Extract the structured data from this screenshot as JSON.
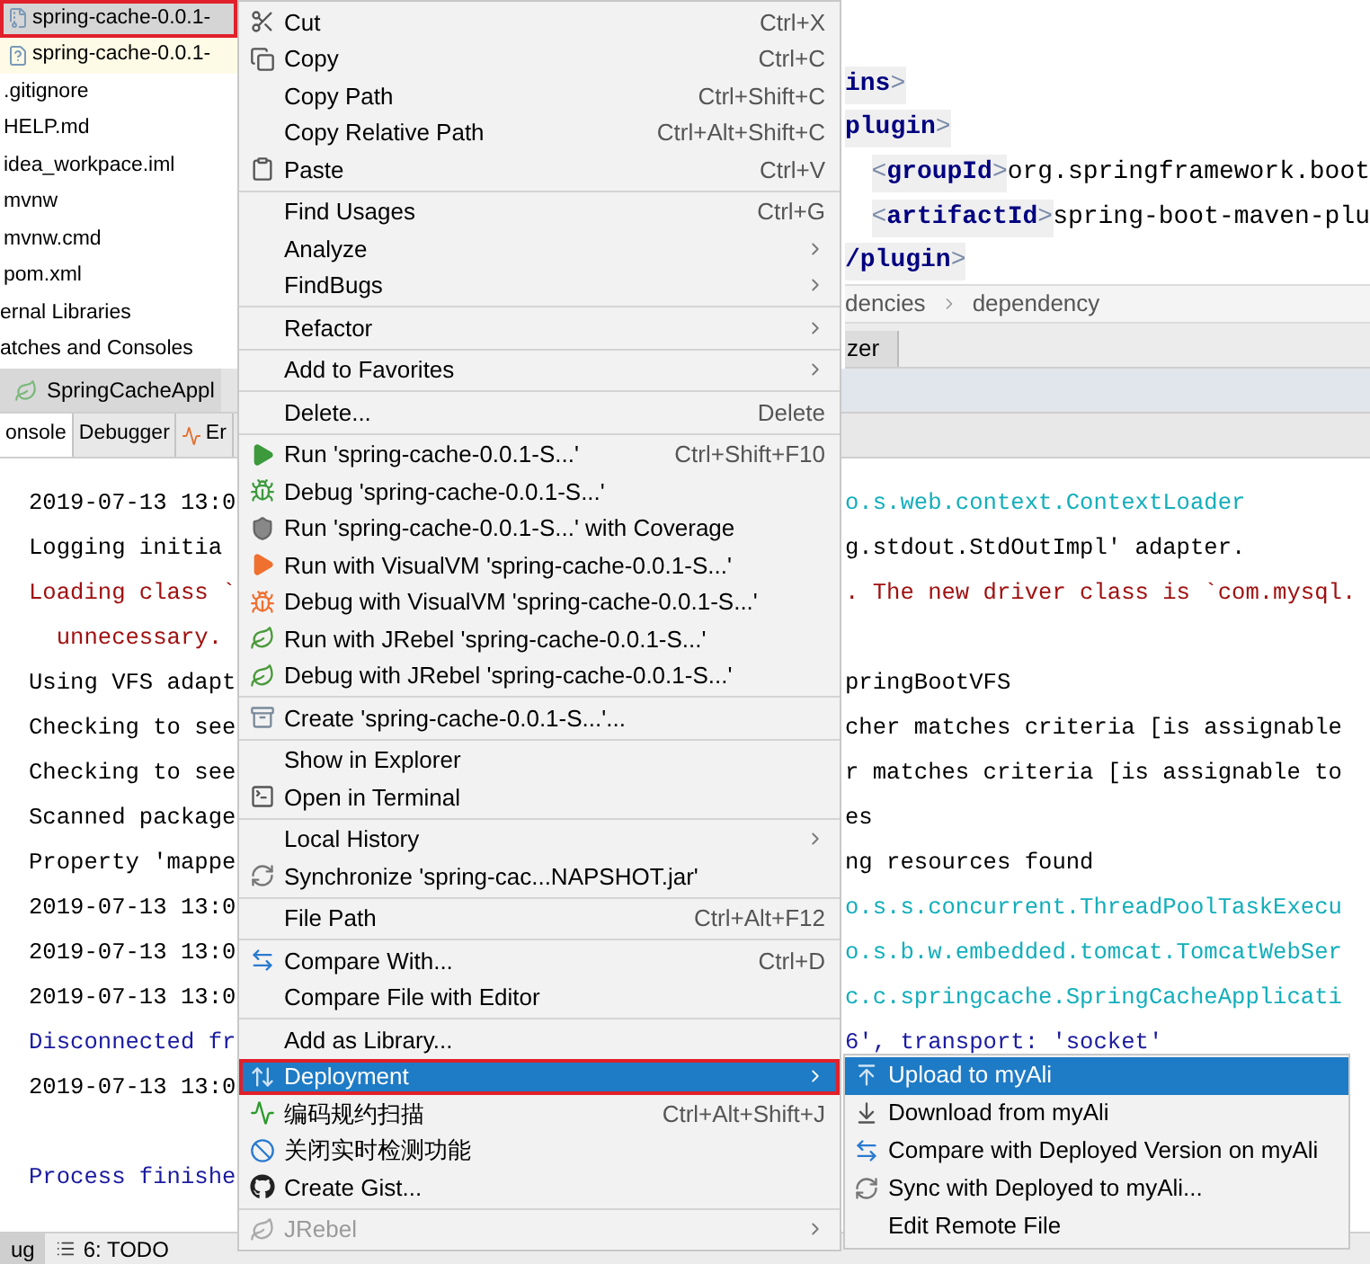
{
  "project_tree": [
    {
      "label": "spring-cache-0.0.1-",
      "kind": "archive",
      "selected": true,
      "highlighted": true
    },
    {
      "label": "spring-cache-0.0.1-",
      "kind": "unknown",
      "selected": false,
      "highlighted": false
    },
    {
      "label": ".gitignore",
      "kind": "file",
      "selected": false,
      "highlighted": false
    },
    {
      "label": "HELP.md",
      "kind": "file",
      "selected": false,
      "highlighted": false
    },
    {
      "label": "idea_workpace.iml",
      "kind": "file",
      "selected": false,
      "highlighted": false
    },
    {
      "label": "mvnw",
      "kind": "file",
      "selected": false,
      "highlighted": false
    },
    {
      "label": "mvnw.cmd",
      "kind": "file",
      "selected": false,
      "highlighted": false
    },
    {
      "label": "pom.xml",
      "kind": "file",
      "selected": false,
      "highlighted": false
    },
    {
      "label": "ernal Libraries",
      "kind": "node",
      "selected": false,
      "highlighted": false
    },
    {
      "label": "atches and Consoles",
      "kind": "node",
      "selected": false,
      "highlighted": false
    }
  ],
  "editor": {
    "lines": [
      [
        {
          "kind": "tag",
          "text": "ins"
        },
        {
          "kind": "punct",
          "text": ">"
        }
      ],
      [
        {
          "kind": "tag",
          "text": "plugin"
        },
        {
          "kind": "punct",
          "text": ">"
        }
      ],
      [
        {
          "kind": "indent"
        },
        {
          "kind": "punct",
          "text": "<"
        },
        {
          "kind": "tag",
          "text": "groupId"
        },
        {
          "kind": "punct",
          "text": ">"
        },
        {
          "kind": "value",
          "text": "org.springframework.boot"
        }
      ],
      [
        {
          "kind": "indent"
        },
        {
          "kind": "punct",
          "text": "<"
        },
        {
          "kind": "tag",
          "text": "artifactId"
        },
        {
          "kind": "punct",
          "text": ">"
        },
        {
          "kind": "value",
          "text": "spring-boot-maven-plu"
        }
      ],
      [
        {
          "kind": "tag",
          "text": "/plugin"
        },
        {
          "kind": "punct",
          "text": ">"
        }
      ]
    ],
    "breadcrumb": [
      "dencies",
      "dependency"
    ],
    "tool_tab": "zer"
  },
  "run_bar": {
    "title": "SpringCacheAppl"
  },
  "console_tabs": [
    {
      "label": "onsole",
      "selected": true
    },
    {
      "label": "Debugger",
      "selected": false
    },
    {
      "label": "Er",
      "selected": false
    }
  ],
  "console": [
    {
      "left": {
        "kind": "plain",
        "text": "2019-07-13 13:0"
      },
      "right": {
        "kind": "logger",
        "text": "o.s.web.context.ContextLoader"
      }
    },
    {
      "left": {
        "kind": "plain",
        "text": "Logging initia"
      },
      "right": {
        "kind": "plain",
        "text": "g.stdout.StdOutImpl' adapter."
      }
    },
    {
      "left": {
        "kind": "error",
        "text": "Loading class `"
      },
      "right": {
        "kind": "error",
        "text": ". The new driver class is `com.mysql."
      }
    },
    {
      "left": {
        "kind": "error",
        "text": "  unnecessary."
      }
    },
    {
      "left": {
        "kind": "plain",
        "text": "Using VFS adapt"
      },
      "right": {
        "kind": "plain",
        "text": "pringBootVFS"
      }
    },
    {
      "left": {
        "kind": "plain",
        "text": "Checking to see"
      },
      "right": {
        "kind": "plain",
        "text": "cher matches criteria [is assignable"
      }
    },
    {
      "left": {
        "kind": "plain",
        "text": "Checking to see"
      },
      "right": {
        "kind": "plain",
        "text": "r matches criteria [is assignable to"
      }
    },
    {
      "left": {
        "kind": "plain",
        "text": "Scanned package"
      },
      "right": {
        "kind": "plain",
        "text": "es"
      }
    },
    {
      "left": {
        "kind": "plain",
        "text": "Property 'mappe"
      },
      "right": {
        "kind": "plain",
        "text": "ng resources found"
      }
    },
    {
      "left": {
        "kind": "plain",
        "text": "2019-07-13 13:0"
      },
      "right": {
        "kind": "logger",
        "text": "o.s.s.concurrent.ThreadPoolTaskExecu"
      }
    },
    {
      "left": {
        "kind": "plain",
        "text": "2019-07-13 13:0"
      },
      "right": {
        "kind": "logger",
        "text": "o.s.b.w.embedded.tomcat.TomcatWebSer"
      }
    },
    {
      "left": {
        "kind": "plain",
        "text": "2019-07-13 13:0"
      },
      "right": {
        "kind": "logger",
        "text": "c.c.springcache.SpringCacheApplicati"
      }
    },
    {
      "left": {
        "kind": "system",
        "text": "Disconnected fr"
      },
      "right": {
        "kind": "system",
        "text": "6', transport: 'socket'"
      }
    },
    {
      "left": {
        "kind": "plain",
        "text": "2019-07-13 13:0"
      }
    },
    {
      "kind": "blank"
    },
    {
      "left": {
        "kind": "system",
        "text": "Process finishe"
      }
    }
  ],
  "bottom_tabs": [
    {
      "label": "ug",
      "selected": true
    },
    {
      "label": "6: TODO",
      "selected": false
    }
  ],
  "context_menu": [
    {
      "kind": "item",
      "label": "Cut",
      "shortcut": "Ctrl+X",
      "submenu": false,
      "selected": false,
      "disabled": false,
      "highlighted": false
    },
    {
      "kind": "item",
      "label": "Copy",
      "shortcut": "Ctrl+C",
      "submenu": false,
      "selected": false,
      "disabled": false,
      "highlighted": false
    },
    {
      "kind": "item",
      "label": "Copy Path",
      "shortcut": "Ctrl+Shift+C",
      "submenu": false,
      "selected": false,
      "disabled": false,
      "highlighted": false
    },
    {
      "kind": "item",
      "label": "Copy Relative Path",
      "shortcut": "Ctrl+Alt+Shift+C",
      "submenu": false,
      "selected": false,
      "disabled": false,
      "highlighted": false
    },
    {
      "kind": "item",
      "label": "Paste",
      "shortcut": "Ctrl+V",
      "submenu": false,
      "selected": false,
      "disabled": false,
      "highlighted": false
    },
    {
      "kind": "separator"
    },
    {
      "kind": "item",
      "label": "Find Usages",
      "shortcut": "Ctrl+G",
      "submenu": false,
      "selected": false,
      "disabled": false,
      "highlighted": false
    },
    {
      "kind": "item",
      "label": "Analyze",
      "submenu": true,
      "selected": false,
      "disabled": false,
      "highlighted": false
    },
    {
      "kind": "item",
      "label": "FindBugs",
      "submenu": true,
      "selected": false,
      "disabled": false,
      "highlighted": false
    },
    {
      "kind": "separator"
    },
    {
      "kind": "item",
      "label": "Refactor",
      "submenu": true,
      "selected": false,
      "disabled": false,
      "highlighted": false
    },
    {
      "kind": "separator"
    },
    {
      "kind": "item",
      "label": "Add to Favorites",
      "submenu": true,
      "selected": false,
      "disabled": false,
      "highlighted": false
    },
    {
      "kind": "separator"
    },
    {
      "kind": "item",
      "label": "Delete...",
      "shortcut": "Delete",
      "submenu": false,
      "selected": false,
      "disabled": false,
      "highlighted": false
    },
    {
      "kind": "separator"
    },
    {
      "kind": "item",
      "label": "Run 'spring-cache-0.0.1-S...'",
      "shortcut": "Ctrl+Shift+F10",
      "submenu": false,
      "selected": false,
      "disabled": false,
      "highlighted": false
    },
    {
      "kind": "item",
      "label": "Debug 'spring-cache-0.0.1-S...'",
      "submenu": false,
      "selected": false,
      "disabled": false,
      "highlighted": false
    },
    {
      "kind": "item",
      "label": "Run 'spring-cache-0.0.1-S...' with Coverage",
      "submenu": false,
      "selected": false,
      "disabled": false,
      "highlighted": false
    },
    {
      "kind": "item",
      "label": "Run with VisualVM 'spring-cache-0.0.1-S...'",
      "submenu": false,
      "selected": false,
      "disabled": false,
      "highlighted": false
    },
    {
      "kind": "item",
      "label": "Debug with VisualVM 'spring-cache-0.0.1-S...'",
      "submenu": false,
      "selected": false,
      "disabled": false,
      "highlighted": false
    },
    {
      "kind": "item",
      "label": "Run with JRebel 'spring-cache-0.0.1-S...'",
      "submenu": false,
      "selected": false,
      "disabled": false,
      "highlighted": false
    },
    {
      "kind": "item",
      "label": "Debug with JRebel 'spring-cache-0.0.1-S...'",
      "submenu": false,
      "selected": false,
      "disabled": false,
      "highlighted": false
    },
    {
      "kind": "separator"
    },
    {
      "kind": "item",
      "label": "Create 'spring-cache-0.0.1-S...'...",
      "submenu": false,
      "selected": false,
      "disabled": false,
      "highlighted": false
    },
    {
      "kind": "separator"
    },
    {
      "kind": "item",
      "label": "Show in Explorer",
      "submenu": false,
      "selected": false,
      "disabled": false,
      "highlighted": false
    },
    {
      "kind": "item",
      "label": "Open in Terminal",
      "submenu": false,
      "selected": false,
      "disabled": false,
      "highlighted": false
    },
    {
      "kind": "separator"
    },
    {
      "kind": "item",
      "label": "Local History",
      "submenu": true,
      "selected": false,
      "disabled": false,
      "highlighted": false
    },
    {
      "kind": "item",
      "label": "Synchronize 'spring-cac...NAPSHOT.jar'",
      "submenu": false,
      "selected": false,
      "disabled": false,
      "highlighted": false
    },
    {
      "kind": "separator"
    },
    {
      "kind": "item",
      "label": "File Path",
      "shortcut": "Ctrl+Alt+F12",
      "submenu": false,
      "selected": false,
      "disabled": false,
      "highlighted": false
    },
    {
      "kind": "separator"
    },
    {
      "kind": "item",
      "label": "Compare With...",
      "shortcut": "Ctrl+D",
      "submenu": false,
      "selected": false,
      "disabled": false,
      "highlighted": false
    },
    {
      "kind": "item",
      "label": "Compare File with Editor",
      "submenu": false,
      "selected": false,
      "disabled": false,
      "highlighted": false
    },
    {
      "kind": "separator"
    },
    {
      "kind": "item",
      "label": "Add as Library...",
      "submenu": false,
      "selected": false,
      "disabled": false,
      "highlighted": false
    },
    {
      "kind": "item",
      "label": "Deployment",
      "submenu": true,
      "selected": true,
      "disabled": false,
      "highlighted": true
    },
    {
      "kind": "item",
      "label": "编码规约扫描",
      "shortcut": "Ctrl+Alt+Shift+J",
      "submenu": false,
      "selected": false,
      "disabled": false,
      "highlighted": false
    },
    {
      "kind": "item",
      "label": "关闭实时检测功能",
      "submenu": false,
      "selected": false,
      "disabled": false,
      "highlighted": false
    },
    {
      "kind": "item",
      "label": "Create Gist...",
      "submenu": false,
      "selected": false,
      "disabled": false,
      "highlighted": false
    },
    {
      "kind": "separator"
    },
    {
      "kind": "item",
      "label": "JRebel",
      "submenu": true,
      "selected": false,
      "disabled": true,
      "highlighted": false
    }
  ],
  "deployment_submenu": [
    {
      "label": "Upload to myAli",
      "selected": true
    },
    {
      "label": "Download from myAli",
      "selected": false
    },
    {
      "label": "Compare with Deployed Version on myAli",
      "selected": false
    },
    {
      "label": "Sync with Deployed to myAli...",
      "selected": false
    },
    {
      "label": "Edit Remote File",
      "selected": false
    }
  ]
}
